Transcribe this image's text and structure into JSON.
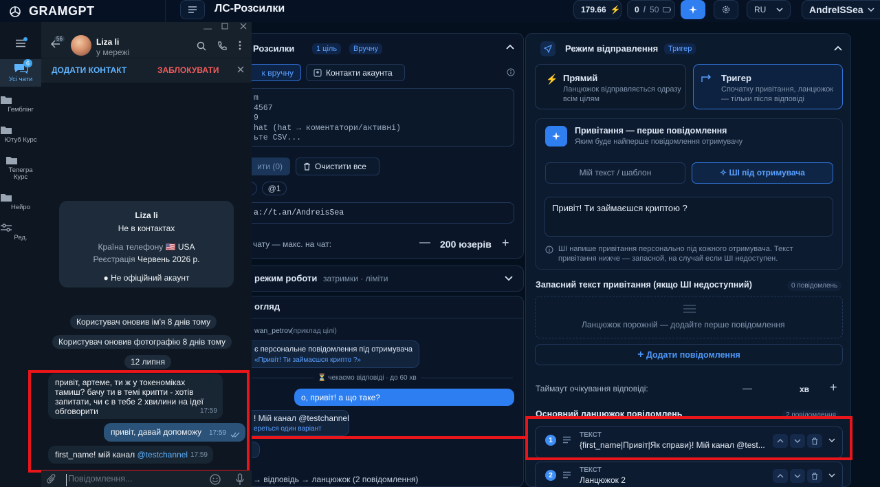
{
  "app": {
    "brand": "GRAMGPT",
    "page_title": "ЛС-Розсилки",
    "balance": "179.66",
    "quota_used": "0",
    "quota_sep": "/",
    "quota_total": "50",
    "language": "RU",
    "username": "AndreISSea"
  },
  "telegram": {
    "rail": [
      {
        "label": "Усі чати",
        "badge": "6"
      },
      {
        "label": "Гемблінг"
      },
      {
        "label": "Ютуб Курс"
      },
      {
        "label": "Телегра Курс"
      },
      {
        "label": "Нейро"
      },
      {
        "label": "Ред."
      }
    ],
    "back_badge": "56",
    "contact_name": "Liza li",
    "contact_status": "у мережі",
    "add_contact": "ДОДАТИ КОНТАКТ",
    "block": "ЗАБЛОКУВАТИ",
    "info": {
      "name": "Liza li",
      "not_in_contacts": "Не в контактах",
      "country_label": "Країна телефону",
      "country_value": "🇺🇸 USA",
      "reg_label": "Реєстрація",
      "reg_value": "Червень 2026 р.",
      "unofficial": "Не офіційний акаунт"
    },
    "service_name_changed": "Користувач оновив ім'я 8 днів тому",
    "service_photo_changed": "Користувач оновив фотографію 8 днів тому",
    "date_chip": "12 липня",
    "messages": [
      {
        "dir": "in",
        "text": "привіт, артеме, ти ж у токеноміках тамиш? бачу ти в темі крипти - хотів запитати, чи є в тебе 2 хвилини на ідеї обговорити",
        "time": "17:59"
      },
      {
        "dir": "out",
        "text": "привіт, давай допоможу",
        "time": "17:59"
      },
      {
        "dir": "in",
        "text_prefix": "first_name! мій канал",
        "link": "@testchannel",
        "time": "17:59"
      }
    ],
    "input_placeholder": "Повідомлення..."
  },
  "middle": {
    "recipients": {
      "title": "Розсилки",
      "tag_count": "1 ціль",
      "tag_mode": "Вручну",
      "tab_manual": "к вручну",
      "tab_contacts": "Контакти акаунта",
      "textarea_lines": [
        "m",
        "4567",
        "9",
        "hat (hat → коментатори/активні)",
        "ьте CSV..."
      ],
      "btn_add": "ити (0)",
      "btn_clear": "Очистити все",
      "chip_mention": "@1",
      "link_value": "a://t.an/AndreisSea",
      "per_chat_label": "чату — макс. на чат:",
      "per_chat_value": "200 юзерів"
    },
    "work_mode": {
      "title": "режим роботи",
      "subtitle": "затримки · ліміти"
    },
    "preview": {
      "title": "огляд",
      "sample_user": "wan_petrov",
      "sample_hint": "(приклад цілі)",
      "ai_msg_line1": "є персональне повідомлення під отримувача",
      "ai_msg_line2": "«Привіт! Ти займаєшся крипто ?»",
      "waiting": "чекаємо відповіді · до 60 хв",
      "reply": "о, привіт! а що таке?",
      "channel_msg": "! Мій канал @testchannel",
      "channel_sub": "ереться один варіант",
      "footer": "→ відповідь → ланцюжок (2 повідомлення)"
    }
  },
  "right": {
    "send_mode": {
      "title": "Режим відправлення",
      "tag": "Тригер"
    },
    "direct": {
      "title": "Прямий",
      "desc": "Ланцюжок відправляється одразу всім цілям"
    },
    "trigger": {
      "title": "Тригер",
      "desc": "Спочатку привітання, ланцюжок — тільки після відповіді"
    },
    "greeting": {
      "title": "Привітання — перше повідомлення",
      "subtitle": "Яким буде найперше повідомлення отримувачу",
      "tab_own": "Мій текст / шаблон",
      "tab_ai": "ШІ під отримувача",
      "text": "Привіт! Ти займаєшся криптою ?",
      "note": "ШІ напише привітання персонально під кожного отримувача. Текст привітання нижче — запасной, на случай если ШІ недоступен."
    },
    "fallback": {
      "title": "Запасний текст привітання (якщо ШІ недоступний)",
      "count": "0 повідомлень",
      "empty": "Ланцюжок порожній — додайте перше повідомлення",
      "add": "Додати повідомлення"
    },
    "timeout": {
      "label": "Таймаут очікування відповіді:",
      "unit": "хв",
      "minus": "—",
      "plus": "+"
    },
    "chain": {
      "title": "Основний ланцюжок повідомлень",
      "count": "2 повідомлення",
      "items": [
        {
          "num": "1",
          "type": "ТЕКСТ",
          "text": "{first_name|Привіт|Як справи}! Мій канал @test..."
        },
        {
          "num": "2",
          "type": "ТЕКСТ",
          "text": "Ланцюжок 2"
        }
      ]
    }
  },
  "colors": {
    "accent": "#3d8df5",
    "highlight": "#e8151a",
    "tg_out": "#2b5278"
  }
}
